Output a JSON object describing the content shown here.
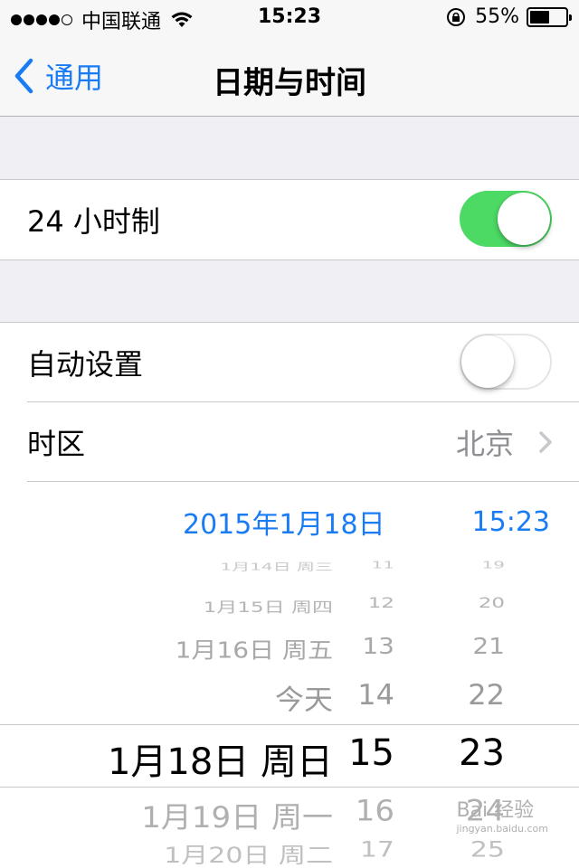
{
  "status_bar": {
    "carrier": "中国联通",
    "time": "15:23",
    "battery_percent": "55%",
    "battery_level": 0.55,
    "signal_bars": 4
  },
  "nav": {
    "back_label": "通用",
    "title": "日期与时间"
  },
  "settings": {
    "hour24": {
      "label": "24 小时制",
      "on": true
    },
    "auto_set": {
      "label": "自动设置",
      "on": false
    },
    "timezone": {
      "label": "时区",
      "value": "北京"
    },
    "current_date": "2015年1月18日",
    "current_time": "15:23"
  },
  "picker": {
    "rows": [
      {
        "date": "1月14日 周三",
        "hour": "11",
        "minute": "19"
      },
      {
        "date": "1月15日 周四",
        "hour": "12",
        "minute": "20"
      },
      {
        "date": "1月16日 周五",
        "hour": "13",
        "minute": "21"
      },
      {
        "date": "今天",
        "hour": "14",
        "minute": "22"
      },
      {
        "date": "1月18日 周日",
        "hour": "15",
        "minute": "23",
        "selected": true
      },
      {
        "date": "1月19日 周一",
        "hour": "16",
        "minute": "24"
      },
      {
        "date": "1月20日 周二",
        "hour": "17",
        "minute": "25"
      }
    ]
  },
  "watermark": {
    "text": "Bai 经验",
    "sub": "jingyan.baidu.com"
  },
  "colors": {
    "accent": "#1a7cf5",
    "toggle_on": "#4cd964",
    "background": "#efeff4"
  }
}
